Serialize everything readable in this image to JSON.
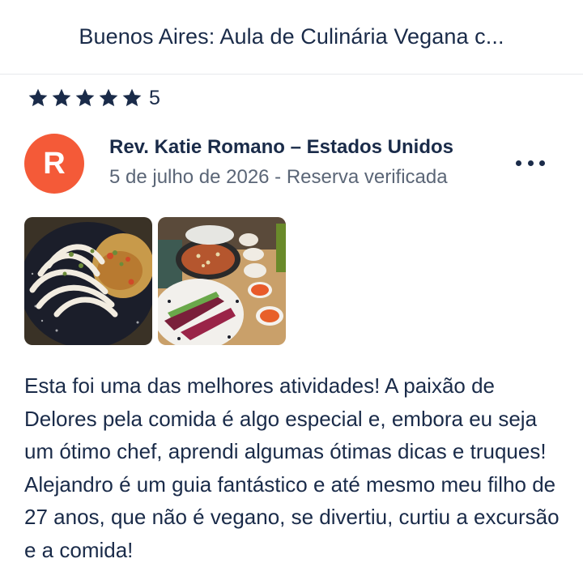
{
  "header": {
    "title": "Buenos Aires: Aula de Culinária Vegana c..."
  },
  "rating": {
    "stars": 5,
    "value": "5"
  },
  "reviewer": {
    "initial": "R",
    "name": "Rev. Katie Romano – Estados Unidos",
    "meta": "5 de julho de 2026 - Reserva verificada",
    "avatar_color": "#f45a38"
  },
  "photos": [
    {
      "icon": "pasta-dish-photo"
    },
    {
      "icon": "table-dishes-photo"
    }
  ],
  "review": {
    "text": "Esta foi uma das melhores atividades! A paixão de Delores pela comida é algo especial e, embora eu seja um ótimo chef, aprendi algumas ótimas dicas e truques! Alejandro é um guia fantástico e até mesmo meu filho de 27 anos, que não é vegano, se divertiu, curtiu a excursão e a comida!"
  },
  "colors": {
    "text": "#1a2b49",
    "muted": "#5b6677",
    "divider": "#e6e8ec"
  }
}
